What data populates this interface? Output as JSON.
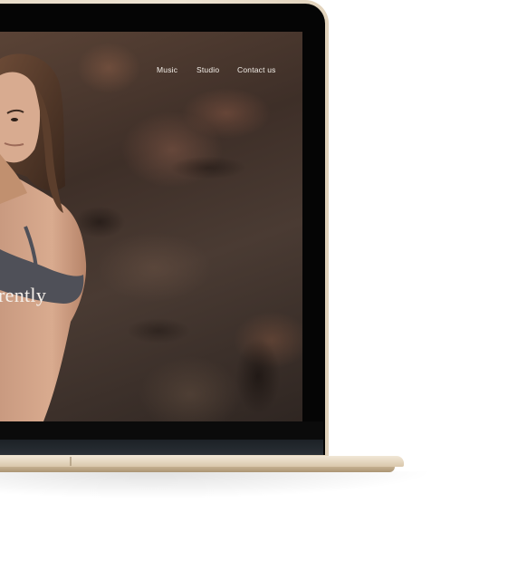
{
  "nav": {
    "items": [
      {
        "label": "Music"
      },
      {
        "label": "Studio"
      },
      {
        "label": "Contact us"
      }
    ]
  },
  "hero": {
    "partial_heading": "rently"
  },
  "colors": {
    "device_gold": "#e9ddc9",
    "bezel": "#050505",
    "nav_text": "#f4efe9"
  }
}
